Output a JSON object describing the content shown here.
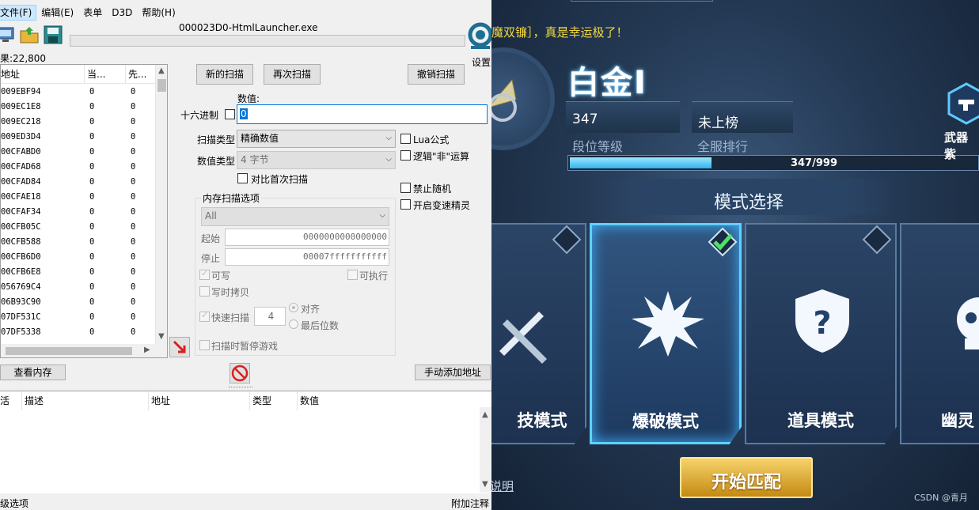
{
  "cheat_engine": {
    "menu": [
      "文件(F)",
      "编辑(E)",
      "表单",
      "D3D",
      "帮助(H)"
    ],
    "process_title": "000023D0-HtmlLauncher.exe",
    "settings_label": "设置",
    "found_label": "果:22,800",
    "address_list": {
      "columns": [
        "地址",
        "当...",
        "先..."
      ],
      "rows": [
        [
          "009EBF94",
          "0",
          "0"
        ],
        [
          "009EC1E8",
          "0",
          "0"
        ],
        [
          "009EC218",
          "0",
          "0"
        ],
        [
          "009ED3D4",
          "0",
          "0"
        ],
        [
          "00CFABD0",
          "0",
          "0"
        ],
        [
          "00CFAD68",
          "0",
          "0"
        ],
        [
          "00CFAD84",
          "0",
          "0"
        ],
        [
          "00CFAE18",
          "0",
          "0"
        ],
        [
          "00CFAF34",
          "0",
          "0"
        ],
        [
          "00CFB05C",
          "0",
          "0"
        ],
        [
          "00CFB588",
          "0",
          "0"
        ],
        [
          "00CFB6D0",
          "0",
          "0"
        ],
        [
          "00CFB6E8",
          "0",
          "0"
        ],
        [
          "056769C4",
          "0",
          "0"
        ],
        [
          "06B93C90",
          "0",
          "0"
        ],
        [
          "07DF531C",
          "0",
          "0"
        ],
        [
          "07DF5338",
          "0",
          "0"
        ]
      ]
    },
    "buttons": {
      "new_scan": "新的扫描",
      "next_scan": "再次扫描",
      "undo_scan": "撤销扫描",
      "view_memory": "查看内存",
      "add_address": "手动添加地址"
    },
    "value_label": "数值:",
    "hex_label": "十六进制",
    "value_input": "0",
    "scan_type_label": "扫描类型",
    "scan_type_value": "精确数值",
    "value_type_label": "数值类型",
    "value_type_value": "4 字节",
    "compare_first": "对比首次扫描",
    "lua_formula": "Lua公式",
    "logic_not": "逻辑\"非\"运算",
    "no_random": "禁止随机",
    "speedhack": "开启变速精灵",
    "mem_options_title": "内存扫描选项",
    "region_value": "All",
    "start_label": "起始",
    "start_value": "0000000000000000",
    "stop_label": "停止",
    "stop_value": "00007fffffffffff",
    "writable": "可写",
    "executable": "可执行",
    "copy_on_write": "写时拷贝",
    "fast_scan": "快速扫描",
    "fast_scan_value": "4",
    "align": "对齐",
    "last_digits": "最后位数",
    "pause_game": "扫描时暂停游戏",
    "cheat_table_columns": [
      "活",
      "描述",
      "地址",
      "类型",
      "数值"
    ],
    "status_left": "级选项",
    "status_right": "附加注释"
  },
  "game": {
    "ticker": "魔双镰］，真是幸运极了！",
    "rank_title": "白金I",
    "rank_level_value": "347",
    "rank_level_caption": "段位等级",
    "server_rank_value": "未上榜",
    "server_rank_caption": "全服排行",
    "progress_text": "347/999",
    "progress_fraction": 0.3474,
    "mode_select": "模式选择",
    "modes": [
      "技模式",
      "爆破模式",
      "道具模式",
      "幽灵"
    ],
    "selected_mode_index": 1,
    "weapon_label": "武器紫",
    "explain_link": "说明",
    "start_button": "开始匹配",
    "watermark": "CSDN @青月",
    "colors": {
      "accent_cyan": "#5fd1ff",
      "gold": "#c58a12",
      "ticker_yellow": "#f2d740"
    }
  }
}
